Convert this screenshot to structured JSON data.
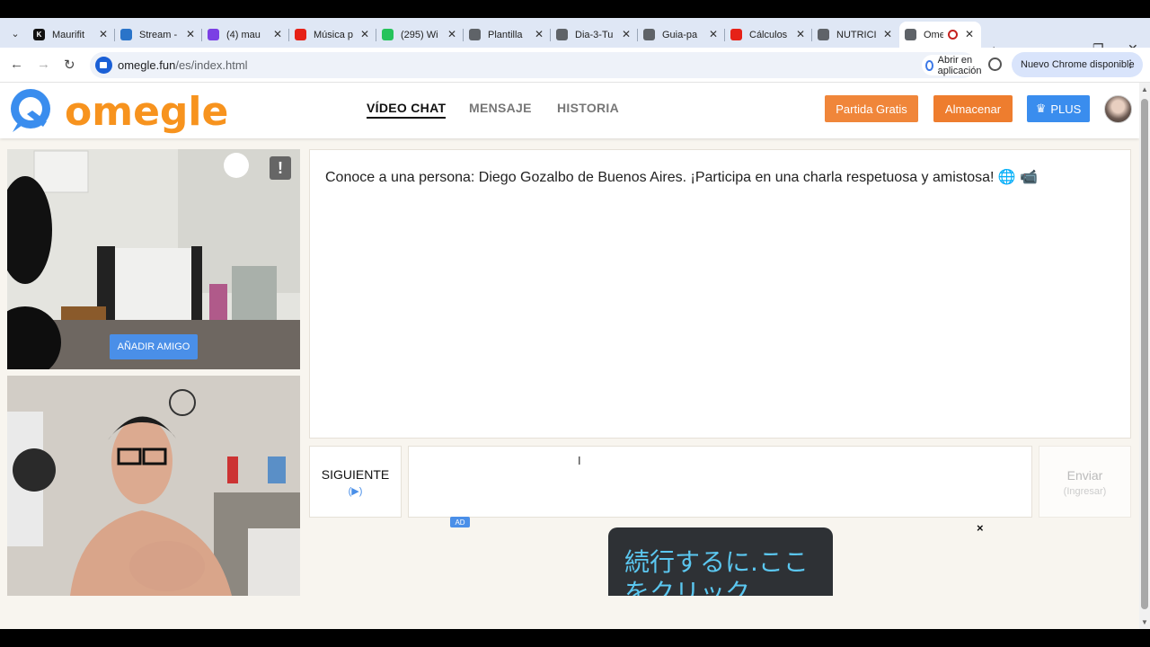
{
  "browser": {
    "tabs": [
      {
        "title": "Maurifit",
        "fav_color": "#111111",
        "fav_text": "K"
      },
      {
        "title": "Stream -",
        "fav_color": "#2a74c9",
        "fav_text": ""
      },
      {
        "title": "(4) mau",
        "fav_color": "#7b3fe4",
        "fav_text": ""
      },
      {
        "title": "Música p",
        "fav_color": "#e62117",
        "fav_text": ""
      },
      {
        "title": "(295) Wi",
        "fav_color": "#25c35b",
        "fav_text": ""
      },
      {
        "title": "Plantilla",
        "fav_color": "#5f6368",
        "fav_text": ""
      },
      {
        "title": "Dia-3-Tu",
        "fav_color": "#5f6368",
        "fav_text": ""
      },
      {
        "title": "Guia-pa",
        "fav_color": "#5f6368",
        "fav_text": ""
      },
      {
        "title": "Cálculos",
        "fav_color": "#e62117",
        "fav_text": ""
      },
      {
        "title": "NUTRICI",
        "fav_color": "#5f6368",
        "fav_text": ""
      },
      {
        "title": "Ome",
        "fav_color": "#5f6368",
        "fav_text": "",
        "active": true
      }
    ],
    "url_host": "omegle.fun",
    "url_path": "/es/index.html",
    "open_in_app": "Abrir en aplicación",
    "chrome_update": "Nuevo Chrome disponible"
  },
  "site": {
    "logo_text": "omegle",
    "nav": [
      "VÍDEO CHAT",
      "MENSAJE",
      "HISTORIA"
    ],
    "btn_free": "Partida Gratis",
    "btn_store": "Almacenar",
    "btn_plus": "PLUS"
  },
  "video": {
    "report": "!",
    "add_friend": "AÑADIR AMIGO"
  },
  "chat": {
    "message": "Conoce a una persona: Diego Gozalbo de Buenos Aires. ¡Participa en una charla respetuosa y amistosa! 🌐 📹",
    "next_label": "SIGUIENTE",
    "next_key": "(▶)",
    "send_label": "Enviar",
    "send_key": "(Ingresar)"
  },
  "ad": {
    "badge": "AD",
    "close": "×",
    "text": "続行するに.ここをクリック"
  },
  "colors": {
    "accent_orange": "#f7931e",
    "plus_blue": "#3a8dee"
  }
}
